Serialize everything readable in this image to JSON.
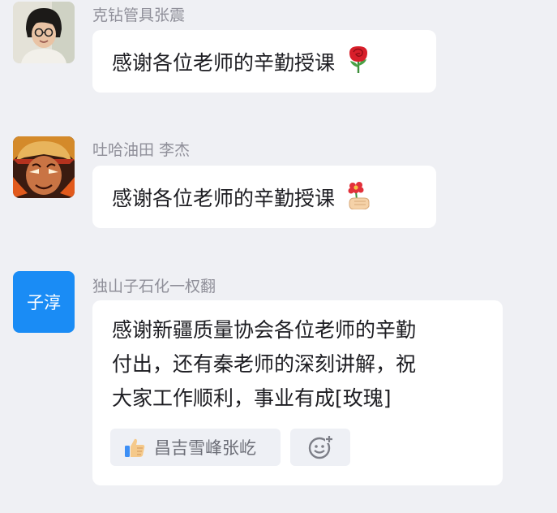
{
  "messages": [
    {
      "sender": "克钻管具张震",
      "text": "感谢各位老师的辛勤授课",
      "emoji": "rose-icon"
    },
    {
      "sender": "吐哈油田 李杰",
      "text": "感谢各位老师的辛勤授课",
      "emoji": "hand-holding-flower-icon"
    },
    {
      "sender": "独山子石化一权翻",
      "avatar_text": "子淳",
      "text": "感谢新疆质量协会各位老师的辛勤\n付出，还有秦老师的深刻讲解，祝\n大家工作顺利，事业有成[玫瑰]",
      "reaction": {
        "icon": "thumbs-up-icon",
        "user": "昌吉雪峰张屹"
      },
      "add_reaction_icon": "add-emoji-icon"
    }
  ],
  "colors": {
    "background": "#eff0f4",
    "bubble": "#ffffff",
    "sender_name": "#8f8f99",
    "avatar_blue": "#1a8cf5"
  }
}
